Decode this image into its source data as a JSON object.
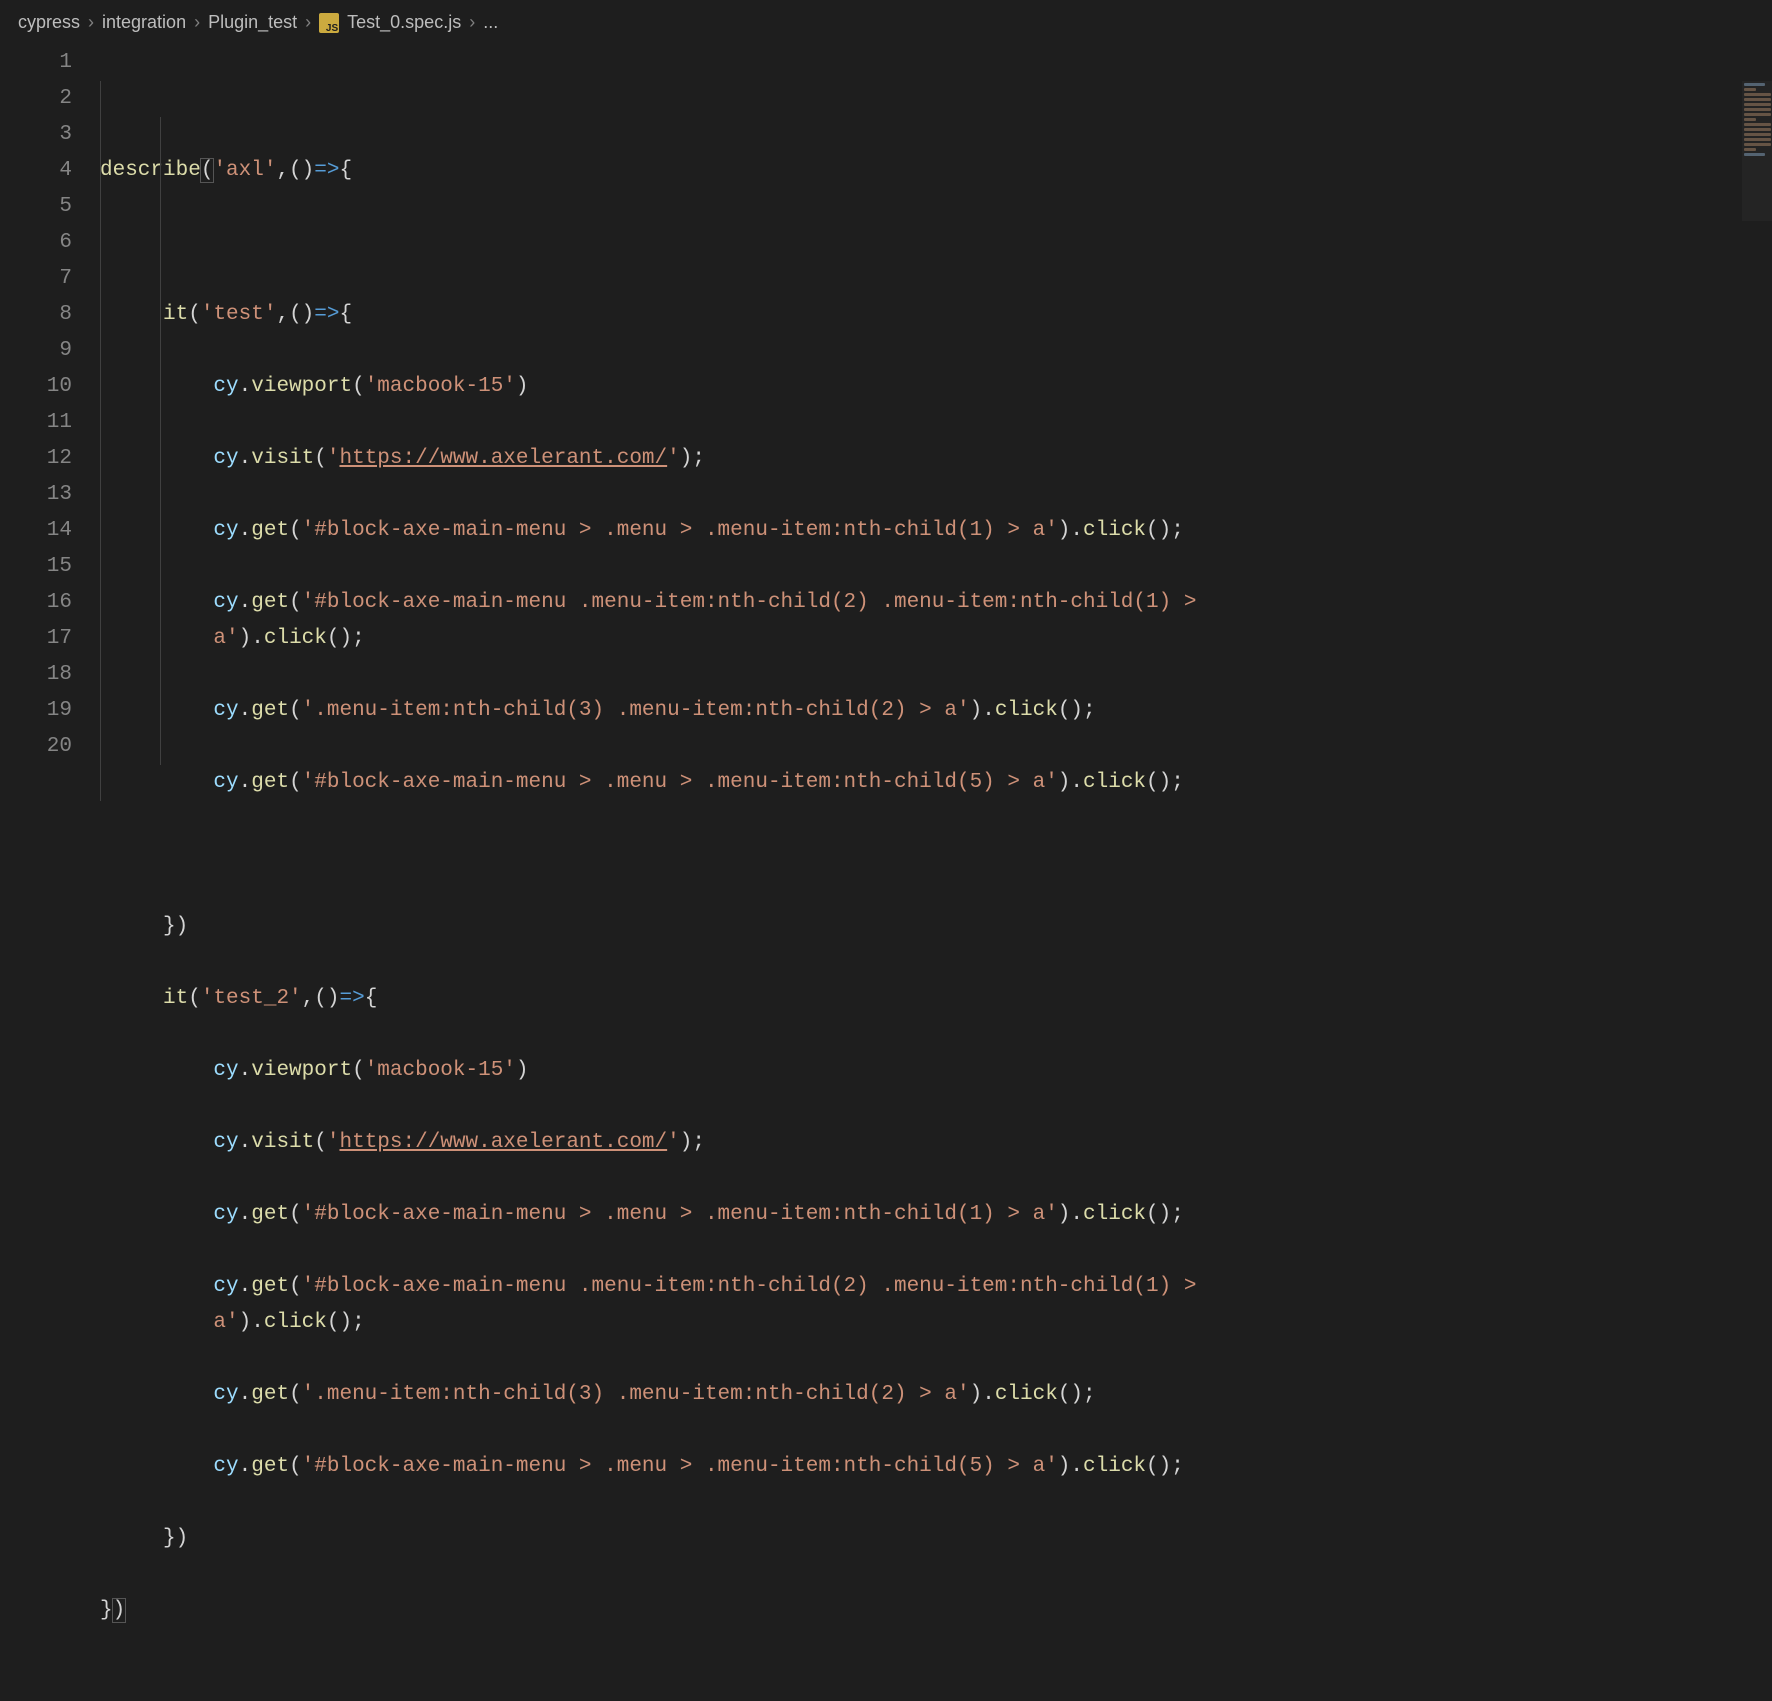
{
  "breadcrumb": {
    "seg0": "cypress",
    "seg1": "integration",
    "seg2": "Plugin_test",
    "seg3": "Test_0.spec.js",
    "seg4": "..."
  },
  "line_numbers": [
    "1",
    "2",
    "3",
    "4",
    "5",
    "6",
    "7",
    "8",
    "9",
    "10",
    "11",
    "12",
    "13",
    "14",
    "15",
    "16",
    "17",
    "18",
    "19",
    "20"
  ],
  "code": {
    "describe": "describe",
    "it": "it",
    "cy": "cy",
    "viewport": "viewport",
    "visit": "visit",
    "get": "get",
    "click": "click",
    "arrow": "=>",
    "str_axl": "'axl'",
    "str_test": "'test'",
    "str_test2": "'test_2'",
    "str_macbook": "'macbook-15'",
    "str_url_open": "'",
    "str_url": "https://www.axelerant.com/",
    "str_url_close": "'",
    "sel1": "'#block-axe-main-menu > .menu > .menu-item:nth-child(1) > a'",
    "sel2a": "'#block-axe-main-menu .menu-item:nth-child(2) .menu-item:nth-child(1) > ",
    "sel2b": "a'",
    "sel3": "'.menu-item:nth-child(3) .menu-item:nth-child(2) > a'",
    "sel4": "'#block-axe-main-menu > .menu > .menu-item:nth-child(5) > a'"
  }
}
